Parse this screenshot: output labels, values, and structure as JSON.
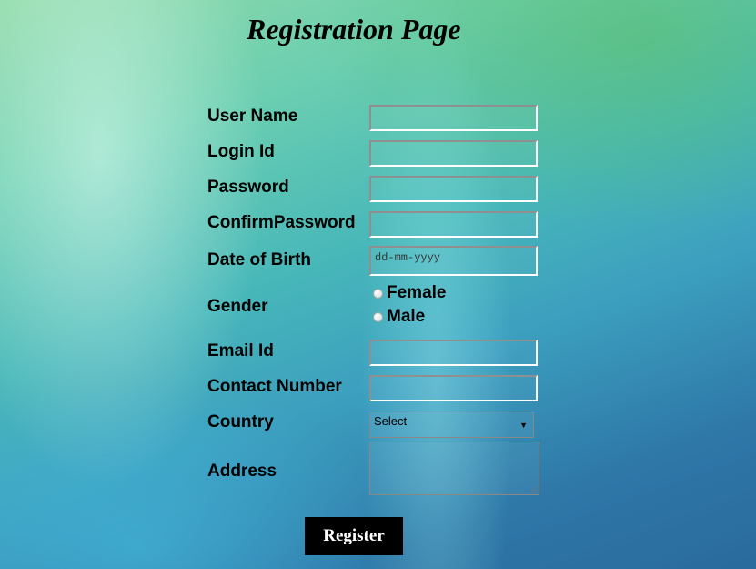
{
  "page_title": "Registration Page",
  "form": {
    "user_name_label": "User Name",
    "login_id_label": "Login Id",
    "password_label": "Password",
    "confirm_password_label": "ConfirmPassword",
    "dob_label": "Date of Birth",
    "dob_placeholder": "dd-mm-yyyy",
    "gender_label": "Gender",
    "gender_options": [
      "Female",
      "Male"
    ],
    "email_label": "Email Id",
    "contact_label": "Contact Number",
    "country_label": "Country",
    "country_selected": "Select",
    "address_label": "Address",
    "register_label": "Register"
  }
}
